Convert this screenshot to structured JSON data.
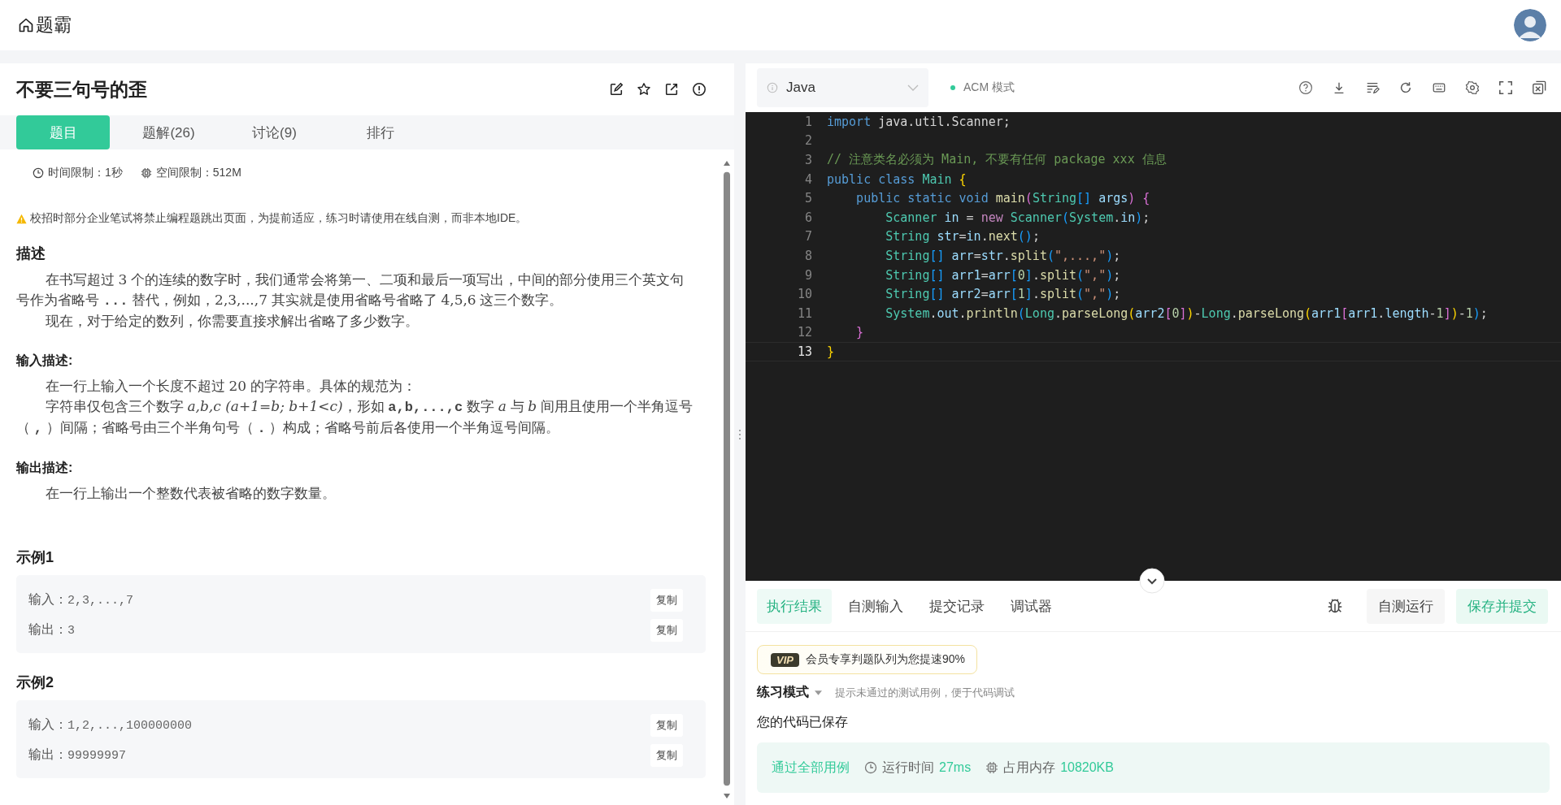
{
  "header": {
    "title": "题霸"
  },
  "problem": {
    "title": "不要三句号的歪",
    "tabs": [
      {
        "label": "题目",
        "selected": true
      },
      {
        "label": "题解(26)",
        "selected": false
      },
      {
        "label": "讨论(9)",
        "selected": false
      },
      {
        "label": "排行",
        "selected": false
      }
    ],
    "limits": [
      {
        "kind": "time",
        "text": "时间限制：1秒"
      },
      {
        "kind": "memory",
        "text": "空间限制：512M"
      }
    ],
    "warning": "校招时部分企业笔试将禁止编程题跳出页面，为提前适应，练习时请使用在线自测，而非本地IDE。",
    "sections": [
      {
        "heading": "描述",
        "paragraphs": [
          [
            {
              "kind": "text",
              "text": "在书写超过 "
            },
            {
              "kind": "math",
              "text": "3"
            },
            {
              "kind": "text",
              "text": " 个的连续的数字时，我们通常会将第一、二项和最后一项写出，中间的部分使用三个英文句号作为省略号 "
            },
            {
              "kind": "code",
              "text": "..."
            },
            {
              "kind": "text",
              "text": " 替代，例如，"
            },
            {
              "kind": "math",
              "text": "2,3,...,7"
            },
            {
              "kind": "text",
              "text": " 其实就是使用省略号省略了 "
            },
            {
              "kind": "math",
              "text": "4,5,6"
            },
            {
              "kind": "text",
              "text": " 这三个数字。"
            }
          ],
          [
            {
              "kind": "text",
              "text": "现在，对于给定的数列，你需要直接求解出省略了多少数字。"
            }
          ]
        ]
      },
      {
        "heading": "输入描述:",
        "paragraphs": [
          [
            {
              "kind": "text",
              "text": "在一行上输入一个长度不超过 "
            },
            {
              "kind": "math",
              "text": "20"
            },
            {
              "kind": "text",
              "text": " 的字符串。具体的规范为："
            }
          ],
          [
            {
              "kind": "text",
              "text": "字符串仅包含三个数字 "
            },
            {
              "kind": "var",
              "text": "a,b,c"
            },
            {
              "kind": "var",
              "text": " (a+1=b; b+1<c)"
            },
            {
              "kind": "text",
              "text": "，形如 "
            },
            {
              "kind": "code",
              "text": "a,b,...,c"
            },
            {
              "kind": "text",
              "text": " 数字 "
            },
            {
              "kind": "var",
              "text": "a"
            },
            {
              "kind": "text",
              "text": " 与 "
            },
            {
              "kind": "var",
              "text": "b"
            },
            {
              "kind": "text",
              "text": " 间用且使用一个半角逗号（ "
            },
            {
              "kind": "code",
              "text": ","
            },
            {
              "kind": "text",
              "text": " ）间隔；省略号由三个半角句号（ "
            },
            {
              "kind": "code",
              "text": "."
            },
            {
              "kind": "text",
              "text": " ）构成；省略号前后各使用一个半角逗号间隔。"
            }
          ]
        ]
      },
      {
        "heading": "输出描述:",
        "paragraphs": [
          [
            {
              "kind": "text",
              "text": "在一行上输出一个整数代表被省略的数字数量。"
            }
          ]
        ]
      }
    ],
    "examples": [
      {
        "heading": "示例1",
        "rows": [
          {
            "label": "输入：",
            "value": "2,3,...,7",
            "button": "复制"
          },
          {
            "label": "输出：",
            "value": "3",
            "button": "复制"
          }
        ]
      },
      {
        "heading": "示例2",
        "rows": [
          {
            "label": "输入：",
            "value": "1,2,...,100000000",
            "button": "复制"
          },
          {
            "label": "输出：",
            "value": "99999997",
            "button": "复制"
          }
        ]
      }
    ]
  },
  "editor": {
    "language": "Java",
    "mode": "ACM 模式",
    "lines": [
      {
        "number": "1",
        "current": false,
        "tokens": [
          {
            "kind": "keyword",
            "text": "import"
          },
          {
            "kind": "plain",
            "text": " java.util.Scanner;"
          }
        ]
      },
      {
        "number": "2",
        "current": false
      },
      {
        "number": "3",
        "current": false,
        "tokens": [
          {
            "kind": "comment",
            "text": "// 注意类名必须为 Main, 不要有任何 package xxx 信息"
          }
        ]
      },
      {
        "number": "4",
        "current": false,
        "tokens": [
          {
            "kind": "keyword",
            "text": "public"
          },
          {
            "kind": "keyword",
            "text": " class"
          },
          {
            "kind": "type",
            "text": " Main"
          },
          {
            "kind": "bracket",
            "color": "#ffd700",
            "text": " {"
          }
        ]
      },
      {
        "number": "5",
        "current": false,
        "tokens": [
          {
            "kind": "keyword",
            "text": "    public"
          },
          {
            "kind": "keyword",
            "text": " static"
          },
          {
            "kind": "keyword",
            "text": " void"
          },
          {
            "kind": "function",
            "text": " main"
          },
          {
            "kind": "bracket",
            "color": "#da70d6",
            "text": "("
          },
          {
            "kind": "type",
            "text": "String"
          },
          {
            "kind": "bracket",
            "color": "#179fff",
            "text": "[]"
          },
          {
            "kind": "variable",
            "text": " args"
          },
          {
            "kind": "bracket",
            "color": "#da70d6",
            "text": ")"
          },
          {
            "kind": "bracket",
            "color": "#da70d6",
            "text": " {"
          }
        ]
      },
      {
        "number": "6",
        "current": false,
        "tokens": [
          {
            "kind": "type",
            "text": "        Scanner"
          },
          {
            "kind": "variable",
            "text": " in"
          },
          {
            "kind": "plain",
            "text": " = "
          },
          {
            "kind": "control",
            "text": "new"
          },
          {
            "kind": "type",
            "text": " Scanner"
          },
          {
            "kind": "bracket",
            "color": "#179fff",
            "text": "("
          },
          {
            "kind": "type",
            "text": "System"
          },
          {
            "kind": "plain",
            "text": "."
          },
          {
            "kind": "variable",
            "text": "in"
          },
          {
            "kind": "bracket",
            "color": "#179fff",
            "text": ")"
          },
          {
            "kind": "plain",
            "text": ";"
          }
        ]
      },
      {
        "number": "7",
        "current": false,
        "tokens": [
          {
            "kind": "type",
            "text": "        String"
          },
          {
            "kind": "variable",
            "text": " str"
          },
          {
            "kind": "plain",
            "text": "="
          },
          {
            "kind": "variable",
            "text": "in"
          },
          {
            "kind": "plain",
            "text": "."
          },
          {
            "kind": "function",
            "text": "next"
          },
          {
            "kind": "bracket",
            "color": "#179fff",
            "text": "()"
          },
          {
            "kind": "plain",
            "text": ";"
          }
        ]
      },
      {
        "number": "8",
        "current": false,
        "tokens": [
          {
            "kind": "type",
            "text": "        String"
          },
          {
            "kind": "bracket",
            "color": "#179fff",
            "text": "[]"
          },
          {
            "kind": "variable",
            "text": " arr"
          },
          {
            "kind": "plain",
            "text": "="
          },
          {
            "kind": "variable",
            "text": "str"
          },
          {
            "kind": "plain",
            "text": "."
          },
          {
            "kind": "function",
            "text": "split"
          },
          {
            "kind": "bracket",
            "color": "#179fff",
            "text": "("
          },
          {
            "kind": "string",
            "text": "\",...,\""
          },
          {
            "kind": "bracket",
            "color": "#179fff",
            "text": ")"
          },
          {
            "kind": "plain",
            "text": ";"
          }
        ]
      },
      {
        "number": "9",
        "current": false,
        "tokens": [
          {
            "kind": "type",
            "text": "        String"
          },
          {
            "kind": "bracket",
            "color": "#179fff",
            "text": "[]"
          },
          {
            "kind": "variable",
            "text": " arr1"
          },
          {
            "kind": "plain",
            "text": "="
          },
          {
            "kind": "variable",
            "text": "arr"
          },
          {
            "kind": "bracket",
            "color": "#179fff",
            "text": "["
          },
          {
            "kind": "number",
            "text": "0"
          },
          {
            "kind": "bracket",
            "color": "#179fff",
            "text": "]"
          },
          {
            "kind": "plain",
            "text": "."
          },
          {
            "kind": "function",
            "text": "split"
          },
          {
            "kind": "bracket",
            "color": "#179fff",
            "text": "("
          },
          {
            "kind": "string",
            "text": "\",\""
          },
          {
            "kind": "bracket",
            "color": "#179fff",
            "text": ")"
          },
          {
            "kind": "plain",
            "text": ";"
          }
        ]
      },
      {
        "number": "10",
        "current": false,
        "tokens": [
          {
            "kind": "type",
            "text": "        String"
          },
          {
            "kind": "bracket",
            "color": "#179fff",
            "text": "[]"
          },
          {
            "kind": "variable",
            "text": " arr2"
          },
          {
            "kind": "plain",
            "text": "="
          },
          {
            "kind": "variable",
            "text": "arr"
          },
          {
            "kind": "bracket",
            "color": "#179fff",
            "text": "["
          },
          {
            "kind": "number",
            "text": "1"
          },
          {
            "kind": "bracket",
            "color": "#179fff",
            "text": "]"
          },
          {
            "kind": "plain",
            "text": "."
          },
          {
            "kind": "function",
            "text": "split"
          },
          {
            "kind": "bracket",
            "color": "#179fff",
            "text": "("
          },
          {
            "kind": "string",
            "text": "\",\""
          },
          {
            "kind": "bracket",
            "color": "#179fff",
            "text": ")"
          },
          {
            "kind": "plain",
            "text": ";"
          }
        ]
      },
      {
        "number": "11",
        "current": false,
        "tokens": [
          {
            "kind": "type",
            "text": "        System"
          },
          {
            "kind": "plain",
            "text": "."
          },
          {
            "kind": "variable",
            "text": "out"
          },
          {
            "kind": "plain",
            "text": "."
          },
          {
            "kind": "function",
            "text": "println"
          },
          {
            "kind": "bracket",
            "color": "#179fff",
            "text": "("
          },
          {
            "kind": "type",
            "text": "Long"
          },
          {
            "kind": "plain",
            "text": "."
          },
          {
            "kind": "function",
            "text": "parseLong"
          },
          {
            "kind": "bracket",
            "color": "#ffd700",
            "text": "("
          },
          {
            "kind": "variable",
            "text": "arr2"
          },
          {
            "kind": "bracket",
            "color": "#da70d6",
            "text": "["
          },
          {
            "kind": "number",
            "text": "0"
          },
          {
            "kind": "bracket",
            "color": "#da70d6",
            "text": "]"
          },
          {
            "kind": "bracket",
            "color": "#ffd700",
            "text": ")"
          },
          {
            "kind": "plain",
            "text": "-"
          },
          {
            "kind": "type",
            "text": "Long"
          },
          {
            "kind": "plain",
            "text": "."
          },
          {
            "kind": "function",
            "text": "parseLong"
          },
          {
            "kind": "bracket",
            "color": "#ffd700",
            "text": "("
          },
          {
            "kind": "variable",
            "text": "arr1"
          },
          {
            "kind": "bracket",
            "color": "#da70d6",
            "text": "["
          },
          {
            "kind": "variable",
            "text": "arr1"
          },
          {
            "kind": "plain",
            "text": "."
          },
          {
            "kind": "variable",
            "text": "length"
          },
          {
            "kind": "plain",
            "text": "-"
          },
          {
            "kind": "number",
            "text": "1"
          },
          {
            "kind": "bracket",
            "color": "#da70d6",
            "text": "]"
          },
          {
            "kind": "bracket",
            "color": "#ffd700",
            "text": ")"
          },
          {
            "kind": "plain",
            "text": "-"
          },
          {
            "kind": "number",
            "text": "1"
          },
          {
            "kind": "bracket",
            "color": "#179fff",
            "text": ")"
          },
          {
            "kind": "plain",
            "text": ";"
          }
        ]
      },
      {
        "number": "12",
        "current": false,
        "tokens": [
          {
            "kind": "bracket",
            "color": "#da70d6",
            "text": "    }"
          }
        ]
      },
      {
        "number": "13",
        "current": true,
        "tokens": [
          {
            "kind": "bracket",
            "color": "#ffd700",
            "text": "}"
          }
        ]
      }
    ]
  },
  "console": {
    "tabs": [
      {
        "label": "执行结果",
        "selected": true
      },
      {
        "label": "自测输入",
        "selected": false
      },
      {
        "label": "提交记录",
        "selected": false
      },
      {
        "label": "调试器",
        "selected": false
      }
    ],
    "buttons": [
      {
        "label": "自测运行",
        "kind": "secondary"
      },
      {
        "label": "保存并提交",
        "kind": "primary"
      }
    ],
    "vip": {
      "badge": "VIP",
      "text": "会员专享判题队列为您提速90%"
    },
    "practice": {
      "label": "练习模式",
      "hint": "提示未通过的测试用例，便于代码调试"
    },
    "message": "您的代码已保存",
    "result": {
      "status": "通过全部用例",
      "time_label": "运行时间",
      "time": "27ms",
      "memory_label": "占用内存",
      "memory": "10820KB"
    }
  }
}
